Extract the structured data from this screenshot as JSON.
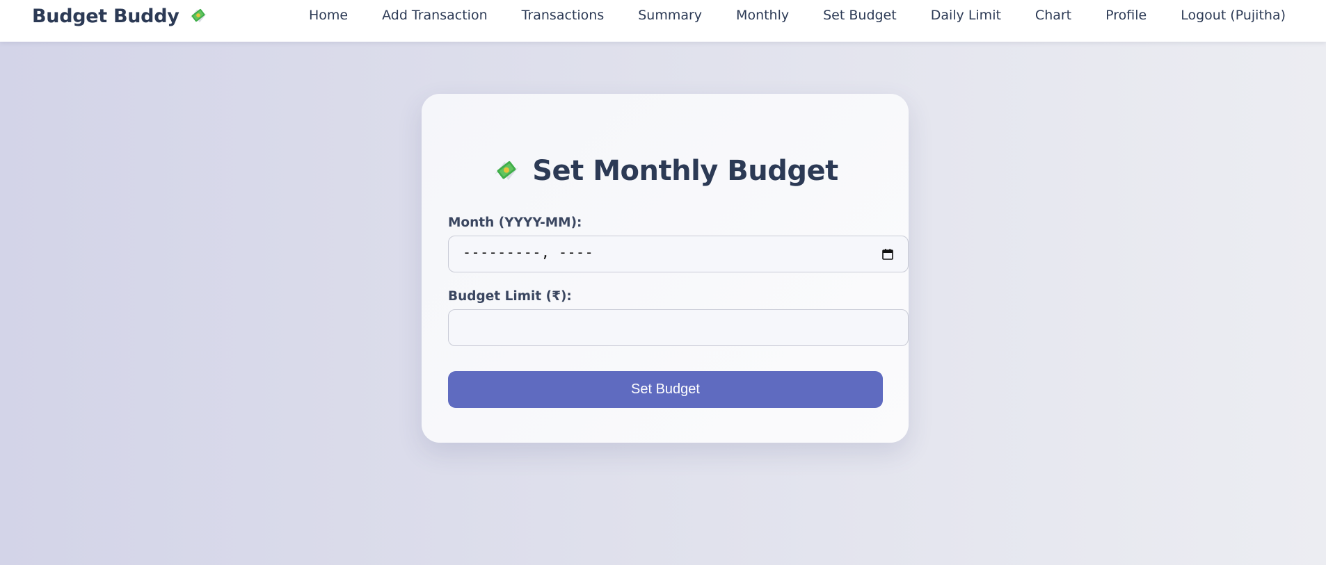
{
  "app": {
    "brand_name": "Budget Buddy",
    "brand_icon": "money-with-wings-icon"
  },
  "nav": {
    "items": [
      {
        "label": "Home"
      },
      {
        "label": "Add Transaction"
      },
      {
        "label": "Transactions"
      },
      {
        "label": "Summary"
      },
      {
        "label": "Monthly"
      },
      {
        "label": "Set Budget"
      },
      {
        "label": "Daily Limit"
      },
      {
        "label": "Chart"
      },
      {
        "label": "Profile"
      },
      {
        "label": "Logout (Pujitha)"
      }
    ]
  },
  "form": {
    "title": "Set Monthly Budget",
    "title_icon": "money-with-wings-icon",
    "month_label": "Month (YYYY-MM):",
    "month_value": "---------, ----",
    "month_icon": "calendar-icon",
    "limit_label": "Budget Limit (₹):",
    "limit_value": "",
    "submit_label": "Set Budget"
  },
  "colors": {
    "primary": "#5f6bc0",
    "text": "#2c3a55",
    "background_left": "#d3d4e8",
    "background_right": "#ecedf2"
  }
}
